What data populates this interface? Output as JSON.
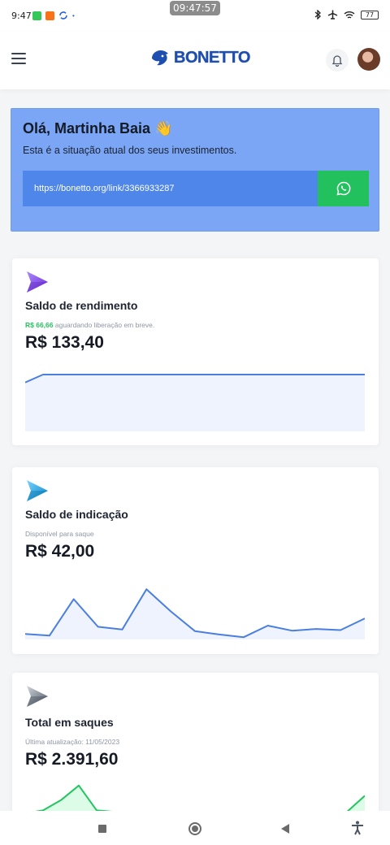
{
  "status_bar": {
    "time": "9:47",
    "clock_overlay": "09:47:57",
    "battery": "77"
  },
  "header": {
    "brand": "BONETTO",
    "icons": [
      "menu-icon",
      "bell-icon",
      "avatar"
    ]
  },
  "welcome": {
    "greeting": "Olá, Martinha Baia 👋",
    "subtitle": "Esta é a situação atual dos seus investimentos.",
    "referral_link": "https://bonetto.org/link/3366933287",
    "share_icon": "whatsapp-icon",
    "background_color": "#7ba6f5",
    "share_color": "#22c15e"
  },
  "cards": [
    {
      "title": "Saldo de rendimento",
      "note_highlight": "R$ 66,66",
      "note_text": " aguardando liberação em breve.",
      "value": "R$ 133,40",
      "icon": "send-icon-purple",
      "sparkline": {
        "stroke": "#4a7fe0",
        "fill": "#eef3fd",
        "values": [
          0.72,
          0.84,
          0.84,
          0.84,
          0.84,
          0.84,
          0.84,
          0.84,
          0.84,
          0.84,
          0.84,
          0.84,
          0.84,
          0.84,
          0.84,
          0.84,
          0.84,
          0.84,
          0.84,
          0.84
        ]
      }
    },
    {
      "title": "Saldo de indicação",
      "note_highlight": "",
      "note_text": "Disponível para saque",
      "value": "R$ 42,00",
      "icon": "send-icon-blue",
      "sparkline": {
        "stroke": "#4a7fe0",
        "fill": "#eef3fd",
        "values": [
          0.07,
          0.04,
          0.7,
          0.2,
          0.15,
          0.88,
          0.48,
          0.12,
          0.06,
          0.01,
          0.22,
          0.13,
          0.16,
          0.14,
          0.35
        ]
      }
    },
    {
      "title": "Total em saques",
      "note_highlight": "",
      "note_text": "Última atualização: 11/05/2023",
      "value": "R$ 2.391,60",
      "icon": "send-icon-gray",
      "sparkline": {
        "stroke": "#22c55e",
        "fill": "#dcfce7",
        "values": [
          0,
          0.1,
          0.45,
          0.95,
          0.1,
          0.05,
          0.05,
          0.05,
          0.05,
          0.05,
          0.05,
          0.05,
          0.05,
          0.05,
          0.05,
          0.05,
          0.05,
          0.05,
          0.05,
          0.6
        ]
      }
    }
  ]
}
